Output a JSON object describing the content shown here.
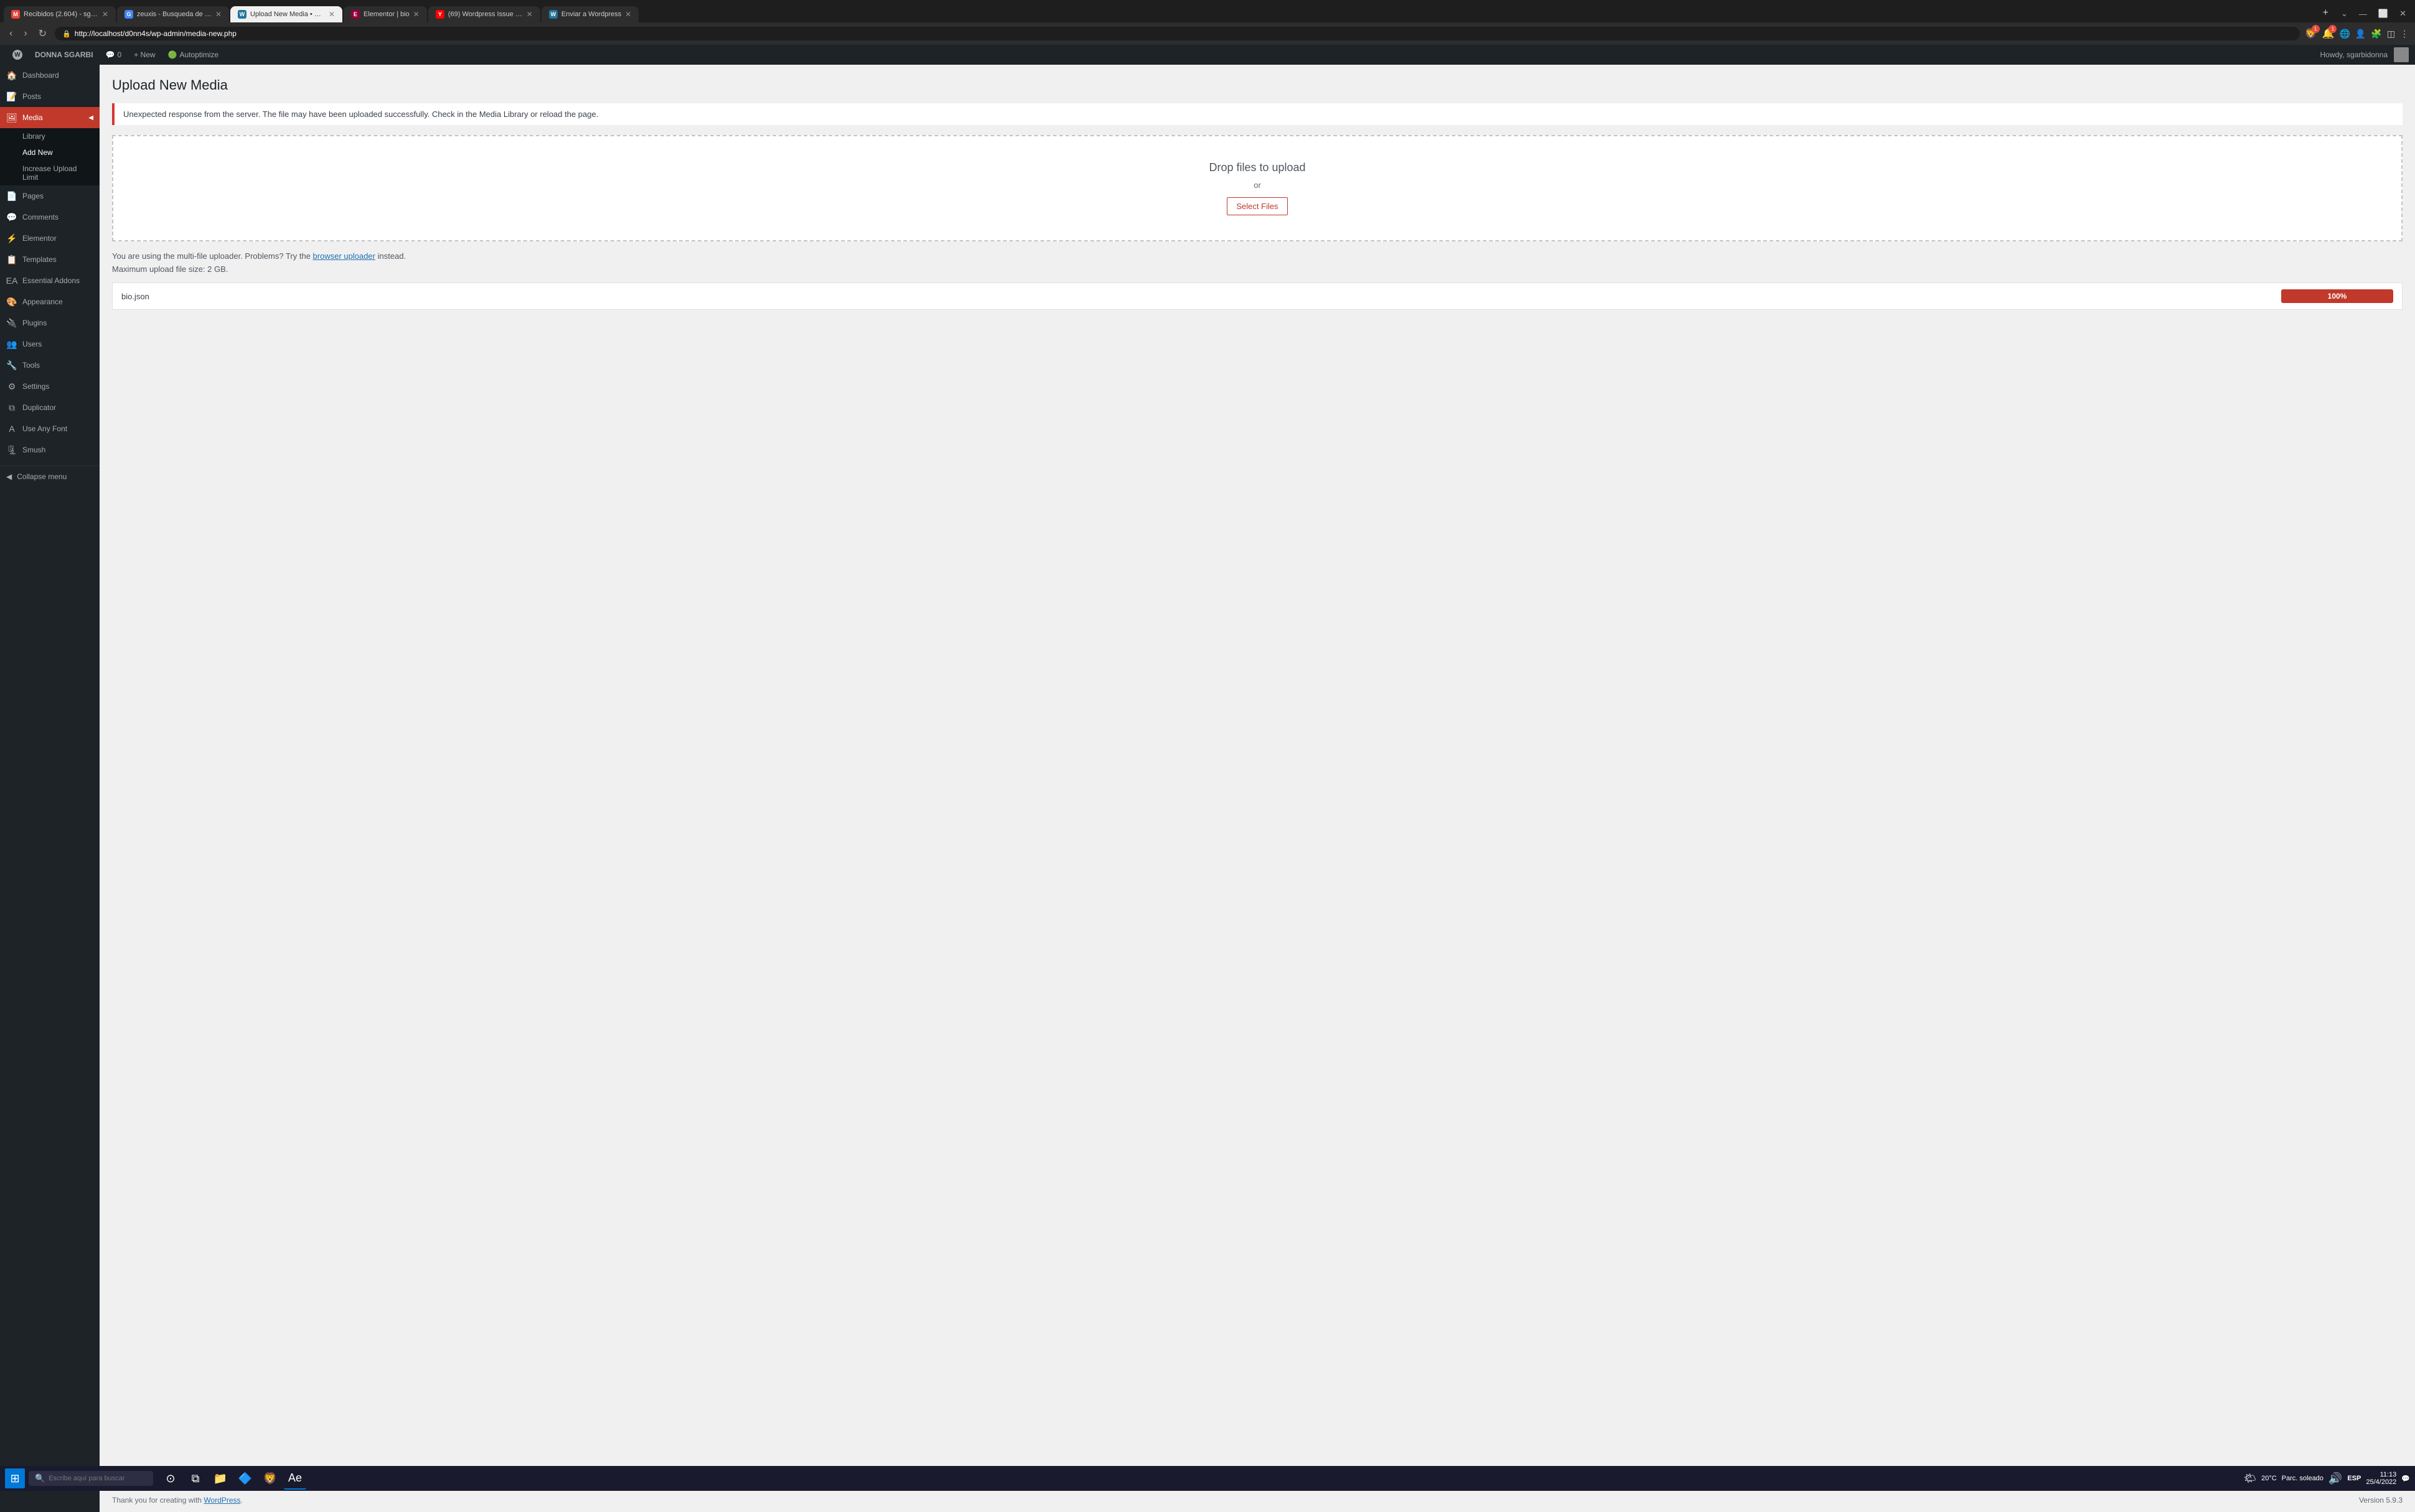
{
  "browser": {
    "tabs": [
      {
        "id": "gmail",
        "label": "Recibidos (2.604) - sgarbidonna...",
        "active": false,
        "color": "#ea4335",
        "letter": "M"
      },
      {
        "id": "google",
        "label": "zeuxis - Busqueda de Google",
        "active": false,
        "color": "#4285f4",
        "letter": "G"
      },
      {
        "id": "wp-upload",
        "label": "Upload New Media • DONN...",
        "active": true,
        "color": "#21759b",
        "letter": "W"
      },
      {
        "id": "elementor",
        "label": "Elementor | bio",
        "active": false,
        "color": "#92003b",
        "letter": "E"
      },
      {
        "id": "youtube",
        "label": "(69) Wordpress Issue Unexpecte...",
        "active": false,
        "color": "#ff0000",
        "letter": "Y"
      },
      {
        "id": "enviar",
        "label": "Enviar a Wordpress",
        "active": false,
        "color": "#21759b",
        "letter": "W"
      }
    ],
    "address": "http://localhost/d0nn4s/wp-admin/media-new.php",
    "shield_badge": "1",
    "alert_badge": "1"
  },
  "admin_bar": {
    "wp_label": "W",
    "site_name": "DONNA SGARBI",
    "comments_label": "0",
    "new_label": "+ New",
    "autoptimize_label": "Autoptimize",
    "howdy": "Howdy, sgarbidonna"
  },
  "sidebar": {
    "dashboard_label": "Dashboard",
    "posts_label": "Posts",
    "media_label": "Media",
    "media_active": true,
    "media_sub": {
      "library": "Library",
      "add_new": "Add New",
      "increase": "Increase Upload Limit"
    },
    "pages_label": "Pages",
    "comments_label": "Comments",
    "elementor_label": "Elementor",
    "templates_label": "Templates",
    "essential_label": "Essential Addons",
    "appearance_label": "Appearance",
    "plugins_label": "Plugins",
    "users_label": "Users",
    "tools_label": "Tools",
    "settings_label": "Settings",
    "duplicator_label": "Duplicator",
    "use_any_font_label": "Use Any Font",
    "smush_label": "Smush",
    "collapse_label": "Collapse menu"
  },
  "main": {
    "page_title": "Upload New Media",
    "notice_text": "Unexpected response from the server. The file may have been uploaded successfully. Check in the Media Library or reload the page.",
    "drop_text": "Drop files to upload",
    "or_text": "or",
    "select_files_label": "Select Files",
    "uploader_info": "You are using the multi-file uploader. Problems? Try the",
    "browser_uploader_link": "browser uploader",
    "uploader_info2": "instead.",
    "max_upload": "Maximum upload file size: 2 GB.",
    "file_name": "bio.json",
    "progress_pct": "100%",
    "footer_thanks": "Thank you for creating with",
    "footer_wp_link": "WordPress",
    "footer_version": "Version 5.9.3"
  },
  "taskbar": {
    "search_placeholder": "Escribe aquí para buscar",
    "weather_icon": "🌤",
    "weather_temp": "20°C",
    "weather_desc": "Parc. soleado",
    "lang": "ESP",
    "time": "11:13",
    "date": "25/4/2022",
    "icons": [
      {
        "name": "cortana",
        "symbol": "⊙"
      },
      {
        "name": "taskview",
        "symbol": "⧉"
      },
      {
        "name": "explorer",
        "symbol": "📁"
      },
      {
        "name": "blender",
        "symbol": "🔷"
      },
      {
        "name": "brave",
        "symbol": "🦁"
      },
      {
        "name": "aftereffects",
        "symbol": "Ae",
        "active": true
      }
    ]
  }
}
